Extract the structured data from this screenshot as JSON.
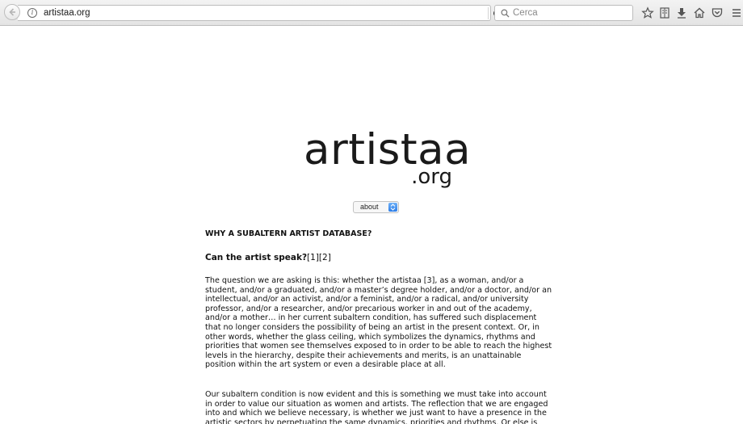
{
  "browser": {
    "url": "artistaa.org",
    "search_placeholder": "Cerca",
    "icons": [
      "back-icon",
      "info-icon",
      "reload-icon",
      "search-icon",
      "bookmark-star-icon",
      "reading-list-icon",
      "download-icon",
      "home-icon",
      "pocket-icon",
      "menu-icon"
    ]
  },
  "page": {
    "logo_main": "artistaa",
    "logo_sub": ".org",
    "select_value": "about",
    "heading": "WHY A SUBALTERN ARTIST DATABASE?",
    "subheading_bold": "Can the artist speak?",
    "subheading_refs": "[1][2]",
    "paragraphs": [
      "The question we are asking is this: whether the artistaa [3], as a woman, and/or a student, and/or a graduated, and/or a master’s degree holder, and/or a doctor, and/or an intellectual, and/or an activist, and/or a feminist, and/or a radical, and/or university professor, and/or a researcher, and/or precarious worker in and out of the academy, and/or a mother… in her current subaltern condition, has suffered such displacement that no longer considers the possibility of being an artist in the present context. Or, in other words, whether the glass ceiling, which symbolizes the dynamics, rhythms and priorities that women see themselves exposed to in order to be able to reach the highest levels in the hierarchy, despite their achievements and merits, is an unattainable position within the art system or even a desirable place at all.",
      "Our subaltern condition is now evident and this is something we must take into account in order to value our situation as women and artists. The reflection that we are engaged into and which we believe necessary, is whether we just want to have a presence in the artistic sectors by perpetuating the same dynamics, priorities and rhythms. Or else is"
    ]
  }
}
